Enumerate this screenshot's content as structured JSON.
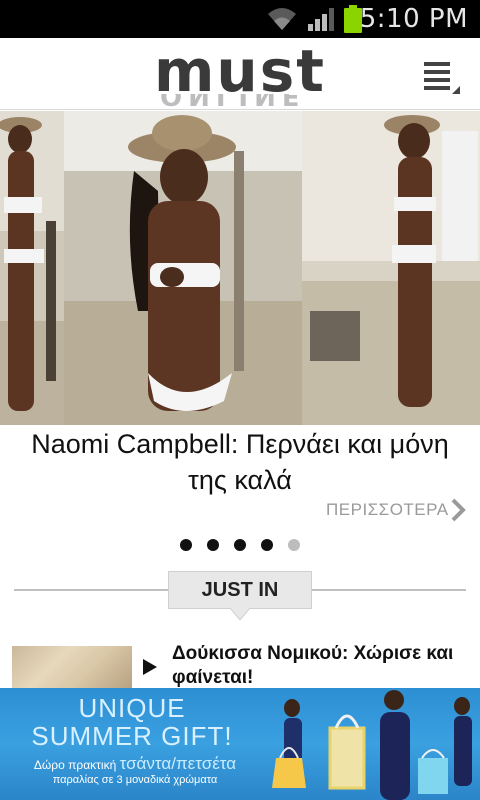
{
  "status_bar": {
    "time": "5:10 PM"
  },
  "app": {
    "logo_main": "must",
    "logo_sub": "ONLINE"
  },
  "hero": {
    "title": "Naomi Campbell: Περνάει και μόνη της καλά",
    "more_label": "ΠΕΡΙΣΣΟΤΕΡΑ",
    "slides_total": 5,
    "active_slide": 1
  },
  "section": {
    "label": "JUST IN"
  },
  "articles": [
    {
      "title": "Δούκισσα Νομικού: Χώρισε και φαίνεται!"
    }
  ],
  "ad": {
    "headline_1": "UNIQUE",
    "headline_2": "SUMMER GIFT!",
    "line_1_prefix": "Δώρο πρακτική ",
    "line_1_highlight": "τσάντα/πετσέτα",
    "line_2": "παραλίας σε 3 μοναδικά χρώματα"
  },
  "colors": {
    "status_bar": "#000000",
    "battery": "#8bd400",
    "ad_background": "#2d8fd3",
    "accent_text": "#111111"
  }
}
